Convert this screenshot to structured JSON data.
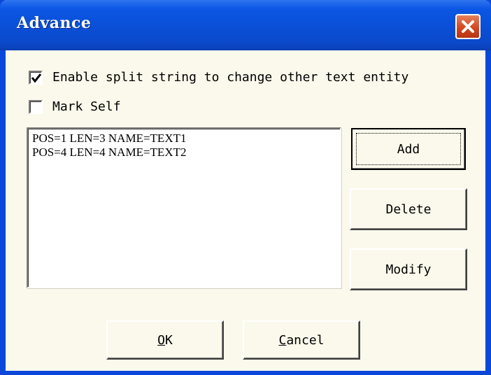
{
  "window": {
    "title": "Advance",
    "close_icon": "close-icon"
  },
  "options": {
    "enable_split": {
      "label": "Enable split string to change other text entity",
      "checked": true
    },
    "mark_self": {
      "label": "Mark Self",
      "checked": false
    }
  },
  "list": {
    "items": [
      "POS=1 LEN=3 NAME=TEXT1",
      "POS=4 LEN=4 NAME=TEXT2"
    ]
  },
  "buttons": {
    "add": "Add",
    "delete": "Delete",
    "modify": "Modify",
    "ok": "OK",
    "cancel": "Cancel"
  },
  "colors": {
    "titlebar": "#0b56e4",
    "close": "#d0441d",
    "dialog_bg": "#fbf9ec"
  }
}
